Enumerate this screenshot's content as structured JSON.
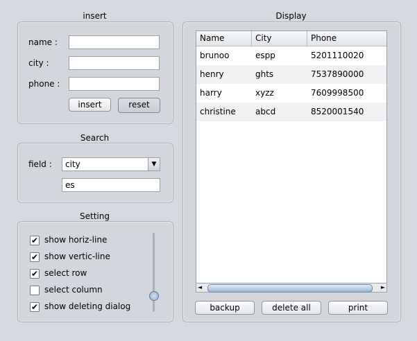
{
  "insert_panel": {
    "title": "insert",
    "name_label": "name :",
    "city_label": "city :",
    "phone_label": "phone :",
    "name_value": "",
    "city_value": "",
    "phone_value": "",
    "insert_label": "insert",
    "reset_label": "reset"
  },
  "search_panel": {
    "title": "Search",
    "field_label": "field :",
    "field_selected": "city",
    "query_value": "es"
  },
  "setting_panel": {
    "title": "Setting",
    "options": [
      {
        "label": "show horiz-line",
        "checked": true
      },
      {
        "label": "show vertic-line",
        "checked": true
      },
      {
        "label": "select row",
        "checked": true
      },
      {
        "label": "select column",
        "checked": false
      },
      {
        "label": "show deleting dialog",
        "checked": true
      }
    ],
    "slider_level": 0.18
  },
  "display_panel": {
    "title": "Display",
    "columns": [
      "Name",
      "City",
      "Phone"
    ],
    "rows": [
      [
        "brunoo",
        "espp",
        "5201110020"
      ],
      [
        "henry",
        "ghts",
        "7537890000"
      ],
      [
        "harry",
        "xyzz",
        "7609998500"
      ],
      [
        "christine",
        "abcd",
        "8520001540"
      ]
    ],
    "backup_label": "backup",
    "delete_all_label": "delete all",
    "print_label": "print",
    "scroll_left_icon": "◄",
    "scroll_right_icon": "►"
  },
  "check_mark": "✔",
  "select_arrow": "▼"
}
